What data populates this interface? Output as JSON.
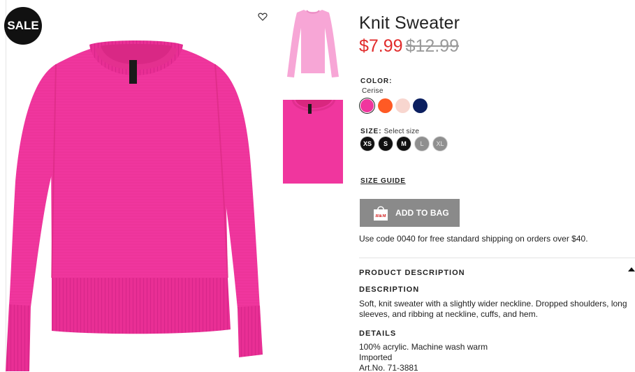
{
  "badge": {
    "sale": "SALE"
  },
  "product": {
    "title": "Knit Sweater",
    "price_sale": "$7.99",
    "price_original": "$12.99"
  },
  "color": {
    "label": "COLOR:",
    "selected": "Cerise",
    "swatches": [
      {
        "name": "cerise",
        "hex": "#f0369e",
        "selected": true
      },
      {
        "name": "orange",
        "hex": "#ff5a24",
        "selected": false
      },
      {
        "name": "light-pink",
        "hex": "#f8d6cf",
        "selected": false
      },
      {
        "name": "navy",
        "hex": "#0b1f60",
        "selected": false
      }
    ]
  },
  "size": {
    "label": "SIZE:",
    "hint": "Select size",
    "options": [
      {
        "label": "XS",
        "available": true
      },
      {
        "label": "S",
        "available": true
      },
      {
        "label": "M",
        "available": true
      },
      {
        "label": "L",
        "available": false
      },
      {
        "label": "XL",
        "available": false
      }
    ]
  },
  "size_guide": "SIZE GUIDE",
  "add_to_bag": "ADD TO BAG",
  "bag_logo": "H&M",
  "promo": "Use code 0040 for free standard shipping on orders over $40.",
  "product_description": {
    "header": "PRODUCT DESCRIPTION",
    "description_label": "DESCRIPTION",
    "description_text": "Soft, knit sweater with a slightly wider neckline. Dropped shoulders, long sleeves, and ribbing at neckline, cuffs, and hem.",
    "details_label": "DETAILS",
    "details": [
      "100% acrylic. Machine wash warm",
      "Imported",
      "Art.No. 71-3881"
    ]
  },
  "colors": {
    "sweater": "#f0369e",
    "sale_red": "#e12c2c",
    "button_grey": "#8a8a8a"
  }
}
